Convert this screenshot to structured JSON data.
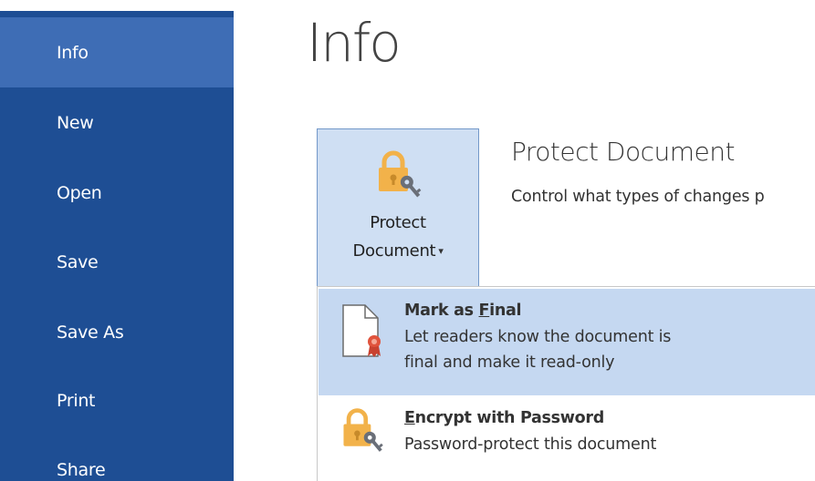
{
  "sidebar": {
    "items": [
      {
        "label": "Info",
        "active": true
      },
      {
        "label": "New"
      },
      {
        "label": "Open"
      },
      {
        "label": "Save"
      },
      {
        "label": "Save As"
      },
      {
        "label": "Print"
      },
      {
        "label": "Share"
      }
    ]
  },
  "main": {
    "title": "Info",
    "protect_button": {
      "line1": "Protect",
      "line2": "Document",
      "caret": "▾"
    },
    "section": {
      "title": "Protect Document",
      "description": "Control what types of changes p"
    }
  },
  "menu": {
    "mark_final": {
      "title_pre": "Mark as ",
      "title_accel": "F",
      "title_post": "inal",
      "desc_line1": "Let readers know the document is",
      "desc_line2": "final and make it read-only"
    },
    "encrypt": {
      "title_accel": "E",
      "title_post": "ncrypt with Password",
      "description": "Password-protect this document"
    }
  },
  "colors": {
    "sidebar_bg": "#1e4e94",
    "sidebar_active": "#3e6db5",
    "button_bg": "#cfdff3",
    "menu_highlight": "#c5d8f1",
    "lock_gold": "#f2b24a"
  },
  "icons": {
    "lock": "lock-key-icon",
    "document_ribbon": "document-ribbon-icon"
  }
}
